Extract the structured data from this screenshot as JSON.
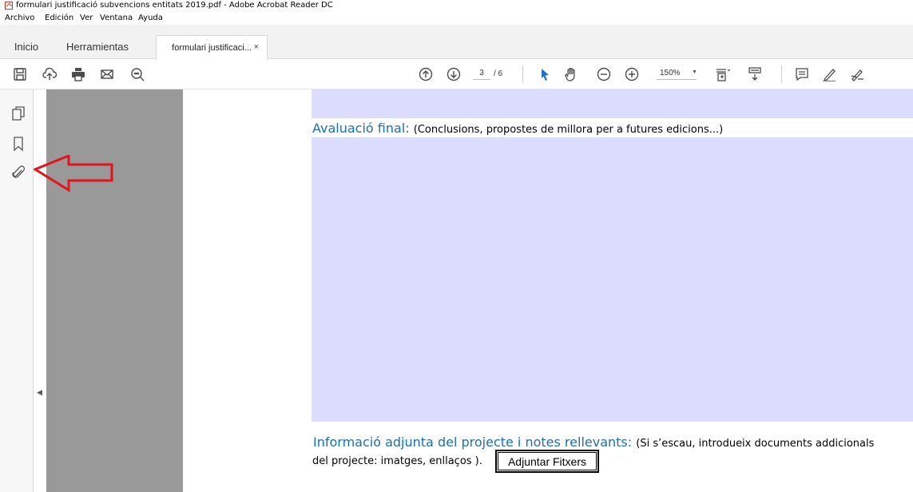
{
  "window": {
    "title": "formulari justificació subvencions entitats 2019.pdf - Adobe Acrobat Reader DC"
  },
  "menu": {
    "items": [
      "Archivo",
      "Edición",
      "Ver",
      "Ventana",
      "Ayuda"
    ]
  },
  "tabs": {
    "home": "Inicio",
    "tools": "Herramientas",
    "document": "formulari justificaci...",
    "close": "×"
  },
  "toolbar": {
    "icons_left": [
      "save-icon",
      "upload-icon",
      "print-icon",
      "email-icon",
      "search-zoom-icon"
    ],
    "current_page": "3",
    "total_pages": "/ 6",
    "zoom": "150%",
    "icons_right": [
      "prev-page-icon",
      "next-page-icon",
      "select-pointer-icon",
      "hand-icon",
      "zoom-out-icon",
      "zoom-in-icon",
      "page-fit-icon",
      "scroll-mode-icon",
      "comment-icon",
      "highlight-pen-icon",
      "sign-icon"
    ]
  },
  "leftnav": {
    "icons": [
      "page-thumbnails-icon",
      "bookmark-icon",
      "attachment-icon"
    ]
  },
  "document": {
    "eval_title": "Avaluació final:",
    "eval_subtitle": "(Conclusions, propostes de millora per a futures edicions...)",
    "info_title": "Informació adjunta del projecte i notes rellevants:",
    "info_subtitle": "(Si s’escau, introdueix documents addicionals",
    "info_line2": "del projecte: imatges, enllaços ).",
    "attach_button": "Adjuntar Fitxers"
  },
  "colors": {
    "field_fill": "#dcdcfe",
    "heading_blue": "#1a6eb5",
    "annotation_red": "#e3141b",
    "margin_gray": "#999999"
  }
}
